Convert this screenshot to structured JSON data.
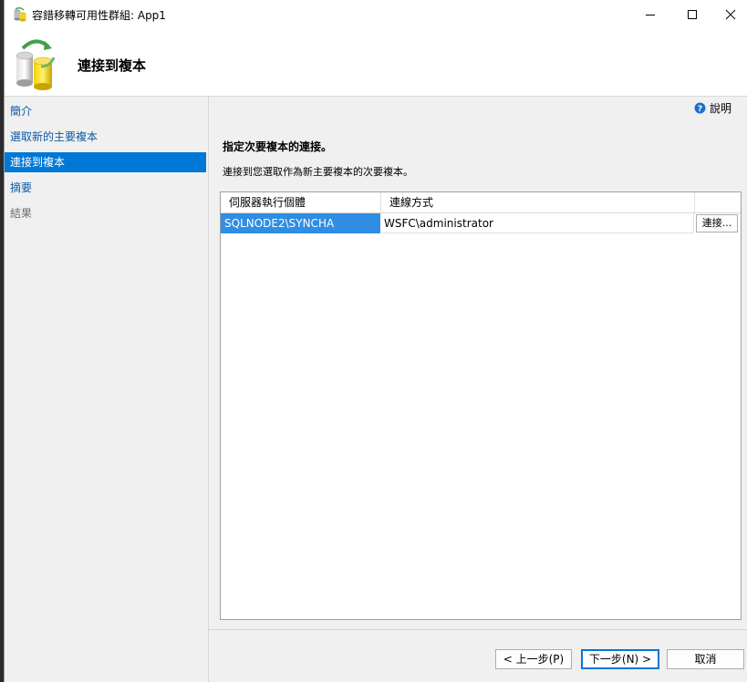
{
  "window": {
    "title": "容錯移轉可用性群組: App1",
    "controls": [
      "minimize-icon",
      "maximize-icon",
      "close-icon"
    ]
  },
  "banner": {
    "title": "連接到複本",
    "icon": "database-sync-icon"
  },
  "nav": {
    "items": [
      {
        "label": "簡介",
        "state": "link"
      },
      {
        "label": "選取新的主要複本",
        "state": "link"
      },
      {
        "label": "連接到複本",
        "state": "selected"
      },
      {
        "label": "摘要",
        "state": "link"
      },
      {
        "label": "結果",
        "state": "disabled"
      }
    ]
  },
  "content": {
    "help_label": "說明",
    "heading": "指定次要複本的連接。",
    "description": "連接到您選取作為新主要複本的次要複本。",
    "grid": {
      "columns": [
        "伺服器執行個體",
        "連線方式"
      ],
      "rows": [
        {
          "server": "SQLNODE2\\SYNCHA",
          "connection": "WSFC\\administrator",
          "button": "連接..."
        }
      ]
    }
  },
  "footer": {
    "back": "< 上一步(P)",
    "next": "下一步(N) >",
    "cancel": "取消"
  },
  "colors": {
    "accent": "#0078d7",
    "selected_cell": "#2f8de4",
    "link": "#0d5aa7",
    "panel_bg": "#f0f0f0"
  }
}
